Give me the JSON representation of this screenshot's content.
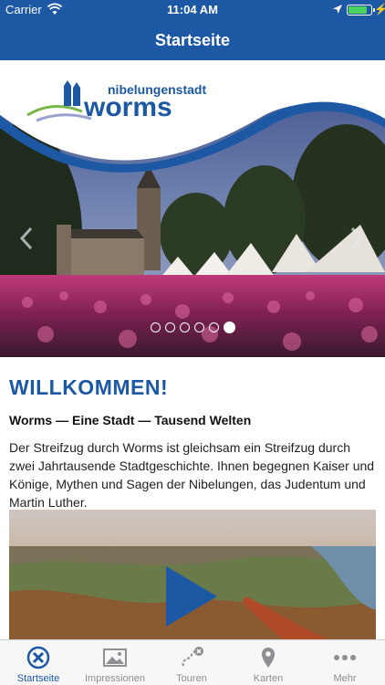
{
  "status_bar": {
    "carrier": "Carrier",
    "time": "11:04 AM"
  },
  "nav": {
    "title": "Startseite"
  },
  "logo": {
    "line1": "nibelungenstadt",
    "line2": "worms"
  },
  "slider": {
    "page_count": 6,
    "active_index": 5
  },
  "content": {
    "welcome": "WILLKOMMEN!",
    "subtitle": "Worms — Eine Stadt — Tausend Welten",
    "body": "Der Streifzug durch Worms ist gleichsam ein Streifzug durch zwei Jahrtausende Stadtgeschichte. Ihnen begegnen Kaiser und Könige, Mythen und Sagen der Nibelungen, das Judentum und Martin Luther."
  },
  "tabs": [
    {
      "label": "Startseite",
      "icon": "home-badge-icon",
      "active": true
    },
    {
      "label": "Impressionen",
      "icon": "image-icon",
      "active": false
    },
    {
      "label": "Touren",
      "icon": "route-icon",
      "active": false
    },
    {
      "label": "Karten",
      "icon": "map-pin-icon",
      "active": false
    },
    {
      "label": "Mehr",
      "icon": "more-icon",
      "active": false
    }
  ],
  "colors": {
    "brand_blue": "#1d58a4",
    "tab_inactive": "#8e8e93"
  }
}
